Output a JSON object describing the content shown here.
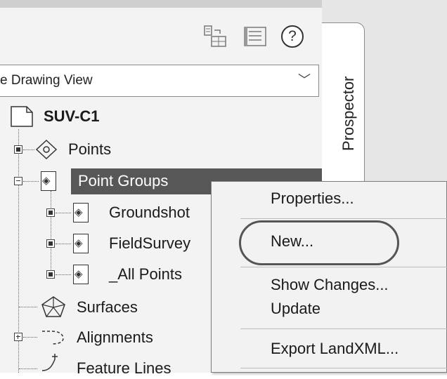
{
  "panel": {
    "vertical_tab": "Prospector",
    "dropdown_value": "e Drawing View"
  },
  "toolbar": {
    "help_label": "?"
  },
  "tree": {
    "root": "SUV-C1",
    "points": "Points",
    "point_groups": "Point Groups",
    "groups": [
      "Groundshot",
      "FieldSurvey",
      "_All Points"
    ],
    "surfaces": "Surfaces",
    "alignments": "Alignments",
    "feature_lines": "Feature Lines"
  },
  "context_menu": {
    "items": [
      "Properties...",
      "New...",
      "Show Changes...",
      "Update",
      "Export LandXML..."
    ]
  },
  "colors": {
    "selection": "#575757",
    "panel_bg": "#f3f3f3"
  }
}
